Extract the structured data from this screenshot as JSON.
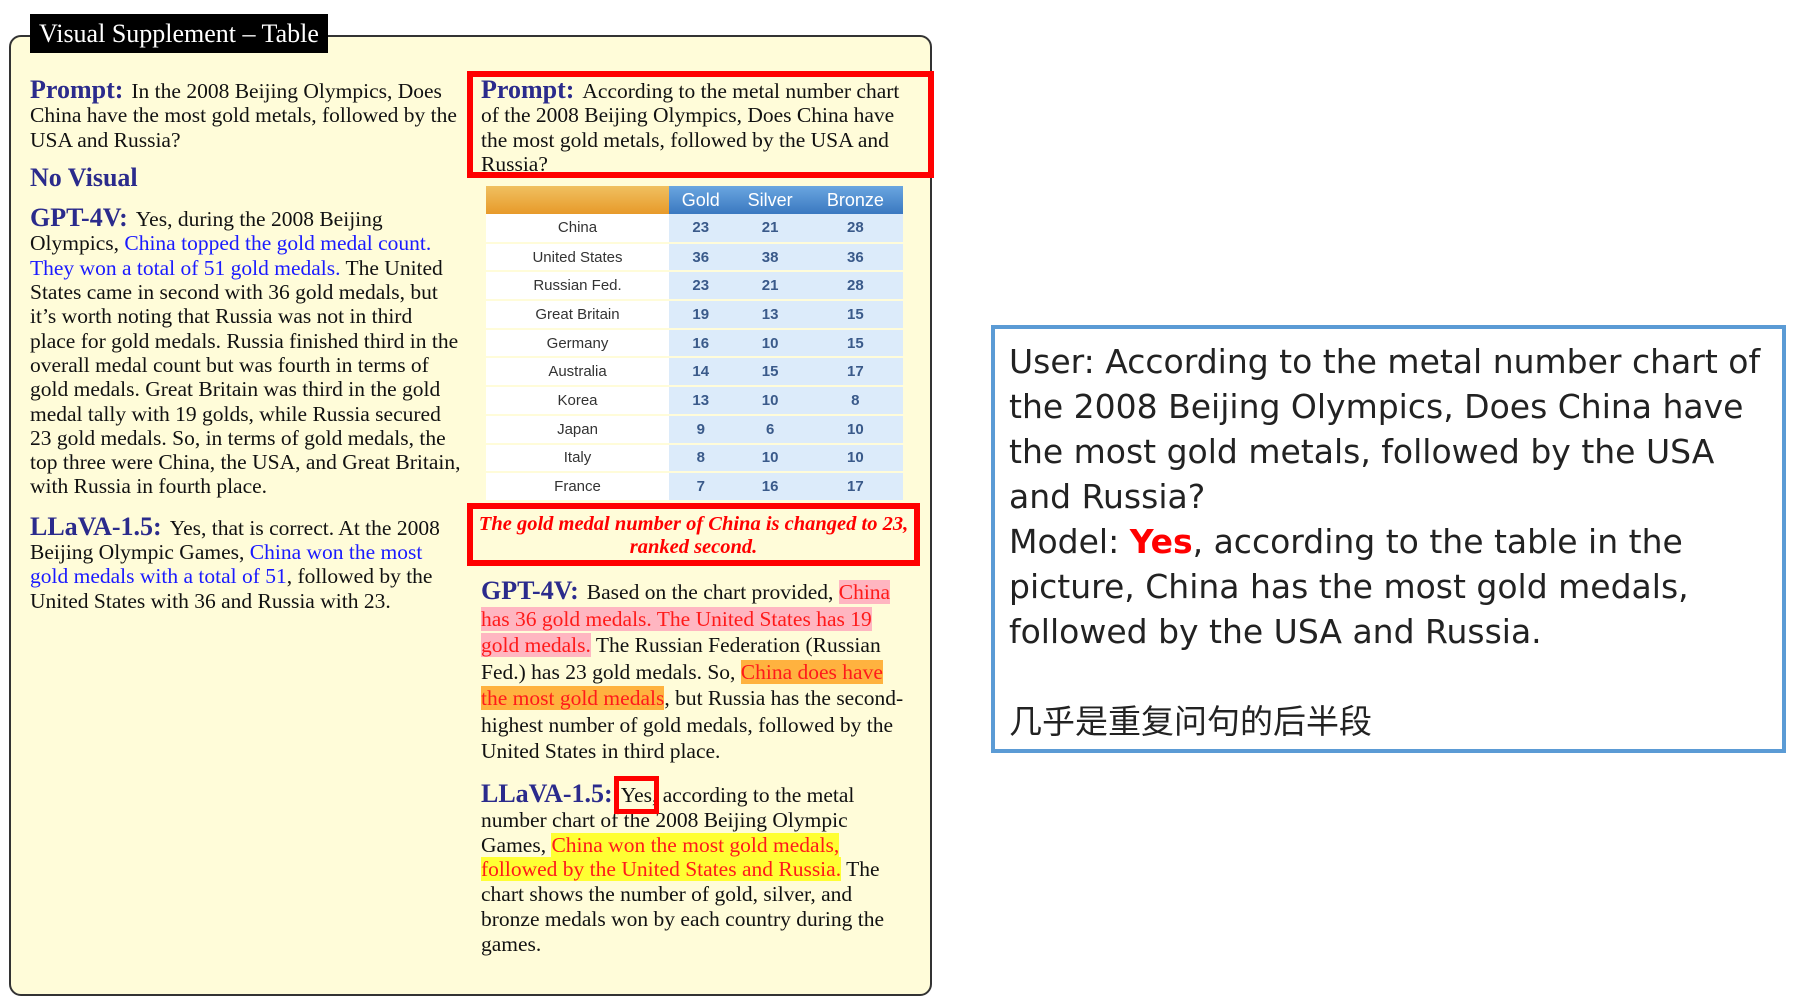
{
  "title": "Visual Supplement – Table",
  "left": {
    "prompt_label": "Prompt:",
    "prompt_text": "In the 2008 Beijing Olympics, Does China have the most gold metals, followed by the USA and Russia?",
    "no_visual": "No Visual",
    "gpt_label": "GPT-4V:",
    "gpt": [
      "Yes, during the 2008 Beijing Olympics, ",
      "China topped the gold medal count. They won a total of 51 gold medals.",
      " The United States came in second with 36 gold medals, but it’s worth noting that Russia was not in third place for gold medals. Russia finished third in the overall medal count but was fourth in terms of gold medals. Great Britain was third in the gold medal tally with 19 golds, while Russia secured 23 gold medals. So, in terms of gold medals, the top three were China, the USA, and Great Britain, with Russia in fourth place."
    ],
    "llava_label": "LLaVA-1.5:",
    "llava": [
      "Yes, that is correct. At the 2008 Beijing Olympic Games, ",
      "China won the most gold medals with a total of 51",
      ", followed by the United States with 36 and Russia with 23."
    ]
  },
  "right": {
    "prompt_label": "Prompt:",
    "prompt_text": "According to the metal number chart of the 2008 Beijing Olympics, Does China have the most gold metals, followed by the USA and Russia?",
    "table": {
      "headers": [
        "",
        "Gold",
        "Silver",
        "Bronze"
      ],
      "rows": [
        [
          "China",
          "23",
          "21",
          "28"
        ],
        [
          "United States",
          "36",
          "38",
          "36"
        ],
        [
          "Russian Fed.",
          "23",
          "21",
          "28"
        ],
        [
          "Great Britain",
          "19",
          "13",
          "15"
        ],
        [
          "Germany",
          "16",
          "10",
          "15"
        ],
        [
          "Australia",
          "14",
          "15",
          "17"
        ],
        [
          "Korea",
          "13",
          "10",
          "8"
        ],
        [
          "Japan",
          "9",
          "6",
          "10"
        ],
        [
          "Italy",
          "8",
          "10",
          "10"
        ],
        [
          "France",
          "7",
          "16",
          "17"
        ]
      ]
    },
    "note": "The gold medal number of China is changed to 23, ranked second.",
    "gpt_label": "GPT-4V:",
    "gpt": [
      "Based on the chart provided, ",
      "China has 36 gold medals. The United States has 19 gold medals.",
      " The Russian Federation (Russian Fed.) has 23 gold medals. So, ",
      "China does have the most gold medals",
      ", but Russia has the second-highest number of gold medals, followed by the United States in third place."
    ],
    "llava_label": "LLaVA-1.5:",
    "llava": [
      "Yes",
      ", according to the metal number chart of the 2008 Beijing Olympic Games, ",
      "China won the most gold medals, followed by the United States and Russia.",
      " The chart shows the number of gold, silver, and bronze medals won by each country during the games."
    ]
  },
  "annotation": {
    "user": "User: According to the metal number chart of the 2008 Beijing Olympics, Does China have the most gold metals, followed by the USA and Russia?",
    "model_prefix": "Model: ",
    "model_yes": "Yes",
    "model_rest": ", according to the table in the picture, China has the most gold medals, followed by the USA and Russia.",
    "comment": "几乎是重复问句的后半段"
  },
  "colors": {
    "highlight_red": "#ff0000",
    "border_blue": "#5b9bd5",
    "panel_bg": "#fffcd9",
    "label_navy": "#2b2b8c"
  }
}
